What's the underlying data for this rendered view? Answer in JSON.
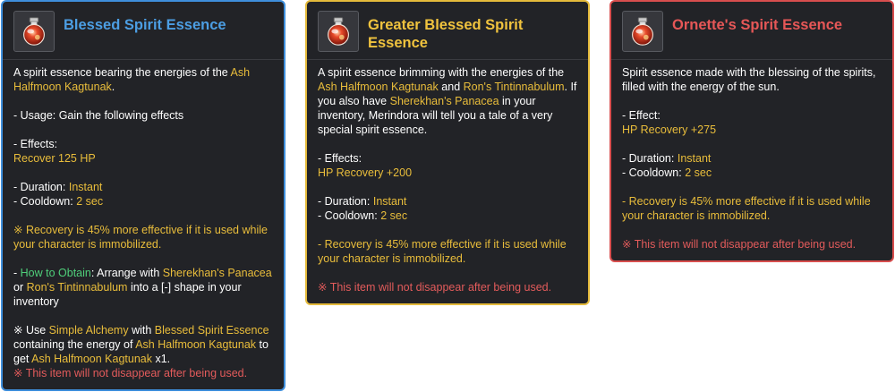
{
  "colors": {
    "blue": "#3f8fdc",
    "gold": "#e4ba3b",
    "red": "#d84e4e",
    "highlight": "#e9bd3b",
    "obtain": "#4fcf7a",
    "warning": "#e35b5b",
    "panel": "#222327"
  },
  "cards": [
    {
      "title": "Blessed Spirit Essence",
      "icon": "spirit-essence-flask-icon",
      "desc_1": "A spirit essence bearing the energies of the ",
      "desc_ash": "Ash Halfmoon Kagtunak",
      "desc_2": ".",
      "usage": "- Usage: Gain the following effects",
      "effects_label": "- Effects:",
      "effects_value": "Recover 125 HP",
      "duration_label": "- Duration: ",
      "duration_value": "Instant",
      "cooldown_label": "- Cooldown: ",
      "cooldown_value": "2 sec",
      "recovery_note": "※ Recovery is 45% more effective if it is used while your character is immobilized.",
      "obtain_dash": "- ",
      "obtain_label": "How to Obtain",
      "obtain_1": ": Arrange with ",
      "obtain_item1": "Sherekhan's Panacea",
      "obtain_2": " or ",
      "obtain_item2": "Ron's Tintinnabulum",
      "obtain_3": " into a [-] shape in your inventory",
      "alch_1": "※ Use ",
      "alch_item1": "Simple Alchemy",
      "alch_2": " with ",
      "alch_item2": "Blessed Spirit Essence",
      "alch_3": " containing the energy of ",
      "alch_item3": "Ash Halfmoon Kagtunak",
      "alch_4": " to get ",
      "alch_item4": "Ash Halfmoon Kagtunak",
      "alch_5": " x1.",
      "persist_note": "※ This item will not disappear after being used."
    },
    {
      "title": "Greater Blessed Spirit Essence",
      "icon": "spirit-essence-flask-icon",
      "desc_1": "A spirit essence brimming with the energies of the ",
      "desc_item1": "Ash Halfmoon Kagtunak",
      "desc_2": " and ",
      "desc_item2": "Ron's Tintinnabulum",
      "desc_3": ". If you also have ",
      "desc_item3": "Sherekhan's Panacea",
      "desc_4": " in your inventory, Merindora will tell you a tale of a very special spirit essence.",
      "effects_label": "- Effects:",
      "effects_value": "HP Recovery +200",
      "duration_label": "- Duration: ",
      "duration_value": "Instant",
      "cooldown_label": "- Cooldown: ",
      "cooldown_value": "2 sec",
      "recovery_note": "- Recovery is 45% more effective if it is used while your character is immobilized.",
      "persist_note": "※ This item will not disappear after being used."
    },
    {
      "title": "Ornette's Spirit Essence",
      "icon": "spirit-essence-flask-icon",
      "desc": "Spirit essence made with the blessing of the spirits, filled with the energy of the sun.",
      "effect_label": "- Effect:",
      "effect_value": "HP Recovery +275",
      "duration_label": "- Duration: ",
      "duration_value": "Instant",
      "cooldown_label": "- Cooldown: ",
      "cooldown_value": "2 sec",
      "recovery_note": "- Recovery is 45% more effective if it is used while your character is immobilized.",
      "persist_note": "※ This item will not disappear after being used."
    }
  ]
}
